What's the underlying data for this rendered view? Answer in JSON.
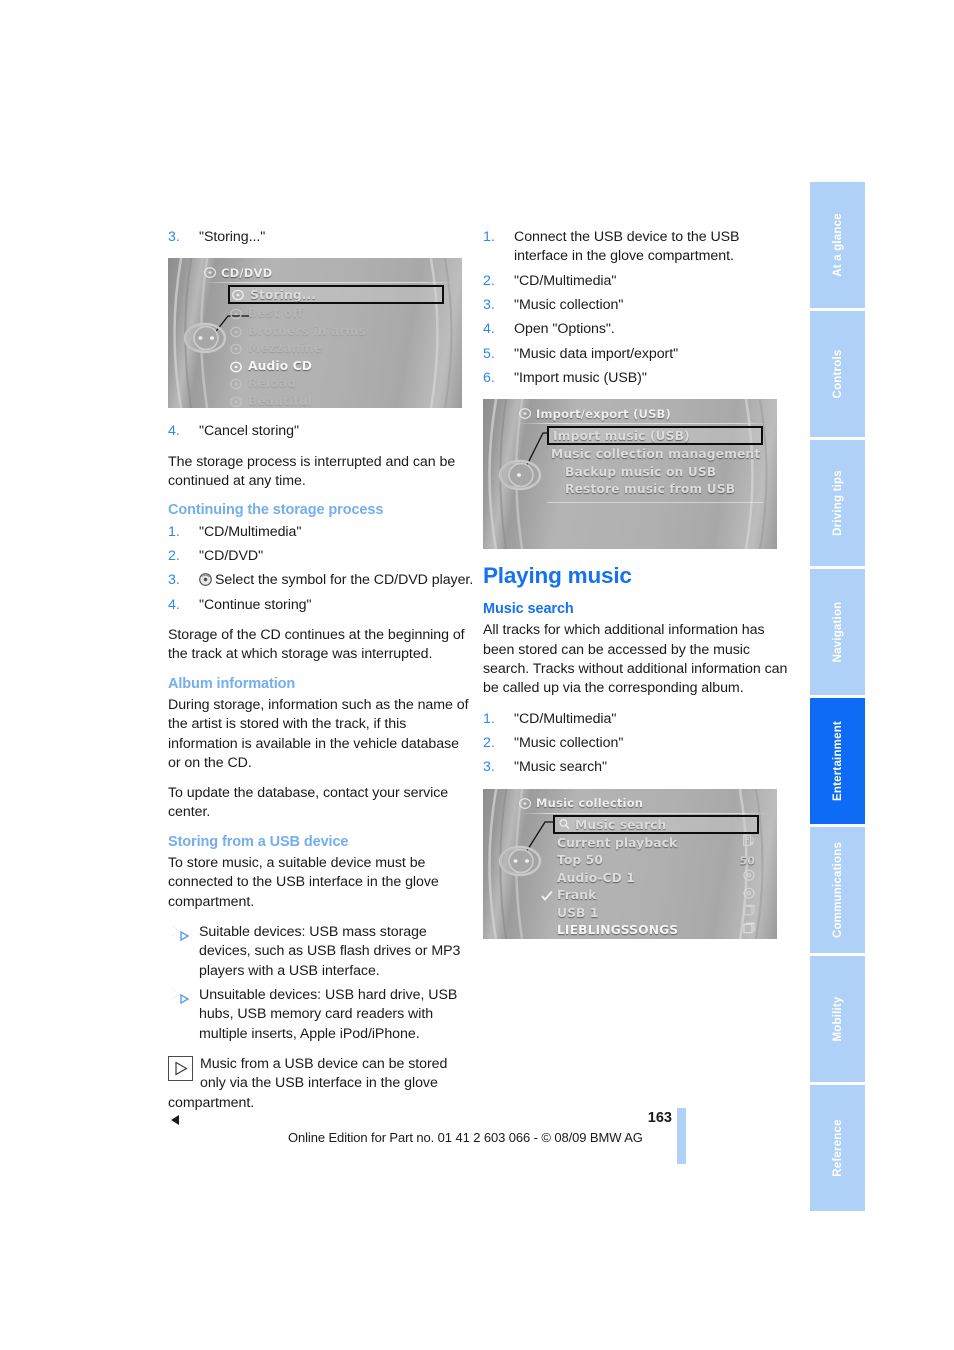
{
  "page": {
    "number": "163",
    "edition_line": "Online Edition for Part no. 01 41 2 603 066 - © 08/09 BMW AG",
    "accent_blue": "#1573EE",
    "soft_blue": "#73AEEE",
    "thumb_blue": "#AFD0F7",
    "thumb_active_blue": "#0E6BF5"
  },
  "thumb_index": {
    "items": [
      {
        "label": "At a glance",
        "active": false
      },
      {
        "label": "Controls",
        "active": false
      },
      {
        "label": "Driving tips",
        "active": false
      },
      {
        "label": "Navigation",
        "active": false
      },
      {
        "label": "Entertainment",
        "active": true
      },
      {
        "label": "Communications",
        "active": false
      },
      {
        "label": "Mobility",
        "active": false
      },
      {
        "label": "Reference",
        "active": false
      }
    ]
  },
  "left_column": {
    "step3": {
      "num": "3.",
      "text": "\"Storing...\""
    },
    "shot_cddvd": {
      "title": "CD/DVD",
      "title_icon": "cd-icon",
      "items": [
        {
          "label": "Storing...",
          "state": "selected",
          "icon": "disc-icon"
        },
        {
          "label": "Best off",
          "state": "dim",
          "icon": "disc-icon"
        },
        {
          "label": "Brothers in arms",
          "state": "dim",
          "icon": "disc-icon"
        },
        {
          "label": "Mezzanine",
          "state": "dim",
          "icon": "disc-icon"
        },
        {
          "label": "Audio CD",
          "state": "bright",
          "icon": "disc-icon"
        },
        {
          "label": "Reload",
          "state": "dim",
          "icon": "disc-icon"
        },
        {
          "label": "Beautiful",
          "state": "dim",
          "icon": "disc-icon"
        }
      ]
    },
    "step4": {
      "num": "4.",
      "text": "\"Cancel storing\""
    },
    "para_interrupt": "The storage process is interrupted and can be continued at any time.",
    "heading_continuing": "Continuing the storage process",
    "continuing_steps": [
      {
        "num": "1.",
        "text": "\"CD/Multimedia\""
      },
      {
        "num": "2.",
        "text": "\"CD/DVD\""
      },
      {
        "num": "3.",
        "text": "Select the symbol for the CD/DVD player.",
        "icon": "disc-icon"
      },
      {
        "num": "4.",
        "text": "\"Continue storing\""
      }
    ],
    "para_continues": "Storage of the CD continues at the beginning of the track at which storage was interrupted.",
    "heading_album": "Album information",
    "para_album_1": "During storage, information such as the name of the artist is stored with the track, if this information is available in the vehicle database or on the CD.",
    "para_album_2": "To update the database, contact your service center.",
    "heading_usb": "Storing from a USB device",
    "para_usb": "To store music, a suitable device must be connected to the USB interface in the glove compartment.",
    "bullets": [
      "Suitable devices: USB mass storage devices, such as USB flash drives or MP3 players with a USB interface.",
      "Unsuitable devices: USB hard drive, USB hubs, USB memory card readers with multiple inserts, Apple iPod/iPhone."
    ],
    "note": {
      "icon": "note-triangle-icon",
      "text": "Music from a USB device can be stored only via the USB interface in the glove compartment.",
      "endmark": "end-of-note-marker"
    }
  },
  "right_column": {
    "usb_steps": [
      {
        "num": "1.",
        "text": "Connect the USB device to the USB interface in the glove compartment."
      },
      {
        "num": "2.",
        "text": "\"CD/Multimedia\""
      },
      {
        "num": "3.",
        "text": "\"Music collection\""
      },
      {
        "num": "4.",
        "text": "Open \"Options\"."
      },
      {
        "num": "5.",
        "text": "\"Music data import/export\""
      },
      {
        "num": "6.",
        "text": "\"Import music (USB)\""
      }
    ],
    "shot_import": {
      "title": "Import/export (USB)",
      "title_icon": "cd-icon",
      "items": [
        {
          "label": "Import music (USB)",
          "state": "selected"
        },
        {
          "label": "Music collection management",
          "state": "normal"
        },
        {
          "label": "Backup music on USB",
          "state": "normal"
        },
        {
          "label": "Restore music from USB",
          "state": "normal"
        }
      ]
    },
    "heading_playing": "Playing music",
    "heading_search": "Music search",
    "para_search": "All tracks for which additional information has been stored can be accessed by the music search. Tracks without additional information can be called up via the corresponding album.",
    "search_steps": [
      {
        "num": "1.",
        "text": "\"CD/Multimedia\""
      },
      {
        "num": "2.",
        "text": "\"Music collection\""
      },
      {
        "num": "3.",
        "text": "\"Music search\""
      }
    ],
    "shot_collection": {
      "title": "Music collection",
      "title_icon": "cd-icon",
      "items": [
        {
          "label": "Music search",
          "state": "selected",
          "icon": "magnifier-icon",
          "right": ""
        },
        {
          "label": "Current playback",
          "state": "normal",
          "right": "list-note-icon"
        },
        {
          "label": "Top 50",
          "state": "normal",
          "right": "50"
        },
        {
          "label": "Audio-CD 1",
          "state": "normal",
          "right": "disc-icon"
        },
        {
          "label": "Frank",
          "state": "normal",
          "checkmark": true,
          "right": "disc-icon"
        },
        {
          "label": "USB 1",
          "state": "normal",
          "right": "folder-icon"
        },
        {
          "label": "LIEBLINGSSONGS",
          "state": "bright",
          "right": "folder-icon"
        }
      ]
    }
  }
}
